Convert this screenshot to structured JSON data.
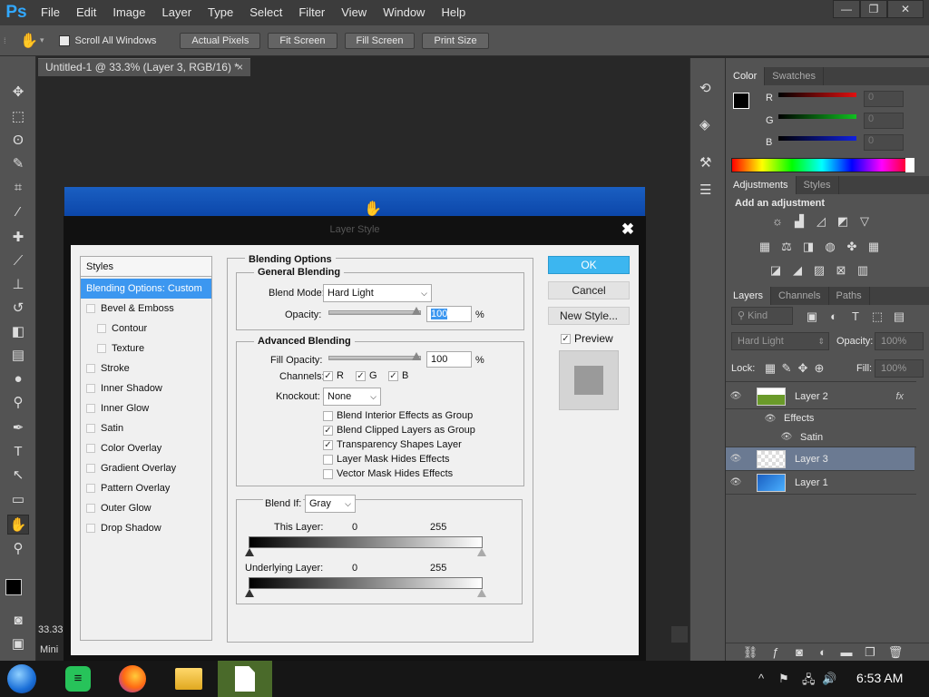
{
  "app": {
    "logo": "Ps",
    "menu": [
      "File",
      "Edit",
      "Image",
      "Layer",
      "Type",
      "Select",
      "Filter",
      "View",
      "Window",
      "Help"
    ]
  },
  "options_bar": {
    "scroll_all": "Scroll All Windows",
    "buttons": [
      "Actual Pixels",
      "Fit Screen",
      "Fill Screen",
      "Print Size"
    ]
  },
  "document": {
    "tab_title": "Untitled-1 @ 33.3% (Layer 3, RGB/16) *",
    "zoom_status": "33.33",
    "mini_label": "Mini"
  },
  "color_panel": {
    "tabs": [
      "Color",
      "Swatches"
    ],
    "channels": [
      {
        "label": "R",
        "value": "0",
        "color": "#e01010"
      },
      {
        "label": "G",
        "value": "0",
        "color": "#10c020"
      },
      {
        "label": "B",
        "value": "0",
        "color": "#1020e0"
      }
    ]
  },
  "adjustments_panel": {
    "tabs": [
      "Adjustments",
      "Styles"
    ],
    "heading": "Add an adjustment"
  },
  "layers_panel": {
    "tabs": [
      "Layers",
      "Channels",
      "Paths"
    ],
    "kind_label": "Kind",
    "blend_mode": "Hard Light",
    "opacity_label": "Opacity:",
    "opacity_value": "100%",
    "lock_label": "Lock:",
    "fill_label": "Fill:",
    "fill_value": "100%",
    "layers": [
      {
        "name": "Layer 2",
        "fx": "fx"
      },
      {
        "name": "Effects"
      },
      {
        "name": "Satin"
      },
      {
        "name": "Layer 3"
      },
      {
        "name": "Layer 1"
      }
    ]
  },
  "dialog": {
    "title": "Layer Style",
    "close": "✖",
    "styles_header": "Styles",
    "styles": [
      {
        "label": "Blending Options: Custom",
        "selected": true
      },
      {
        "label": "Bevel & Emboss"
      },
      {
        "label": "Contour"
      },
      {
        "label": "Texture"
      },
      {
        "label": "Stroke"
      },
      {
        "label": "Inner Shadow"
      },
      {
        "label": "Inner Glow"
      },
      {
        "label": "Satin"
      },
      {
        "label": "Color Overlay"
      },
      {
        "label": "Gradient Overlay"
      },
      {
        "label": "Pattern Overlay"
      },
      {
        "label": "Outer Glow"
      },
      {
        "label": "Drop Shadow"
      }
    ],
    "blending_options": "Blending Options",
    "general_blending": "General Blending",
    "blend_mode_label": "Blend Mode:",
    "blend_mode_value": "Hard Light",
    "opacity_label": "Opacity:",
    "opacity_value": "100",
    "percent": "%",
    "advanced_blending": "Advanced Blending",
    "fill_opacity_label": "Fill Opacity:",
    "fill_opacity_value": "100",
    "channels_label": "Channels:",
    "channels": [
      "R",
      "G",
      "B"
    ],
    "knockout_label": "Knockout:",
    "knockout_value": "None",
    "checkboxes": [
      {
        "label": "Blend Interior Effects as Group",
        "checked": false
      },
      {
        "label": "Blend Clipped Layers as Group",
        "checked": true
      },
      {
        "label": "Transparency Shapes Layer",
        "checked": true
      },
      {
        "label": "Layer Mask Hides Effects",
        "checked": false
      },
      {
        "label": "Vector Mask Hides Effects",
        "checked": false
      }
    ],
    "blend_if_label": "Blend If:",
    "blend_if_value": "Gray",
    "this_layer_label": "This Layer:",
    "underlying_label": "Underlying Layer:",
    "range_min": "0",
    "range_max": "255",
    "ok": "OK",
    "cancel": "Cancel",
    "new_style": "New Style...",
    "preview": "Preview"
  },
  "taskbar": {
    "time": "6:53 AM"
  }
}
